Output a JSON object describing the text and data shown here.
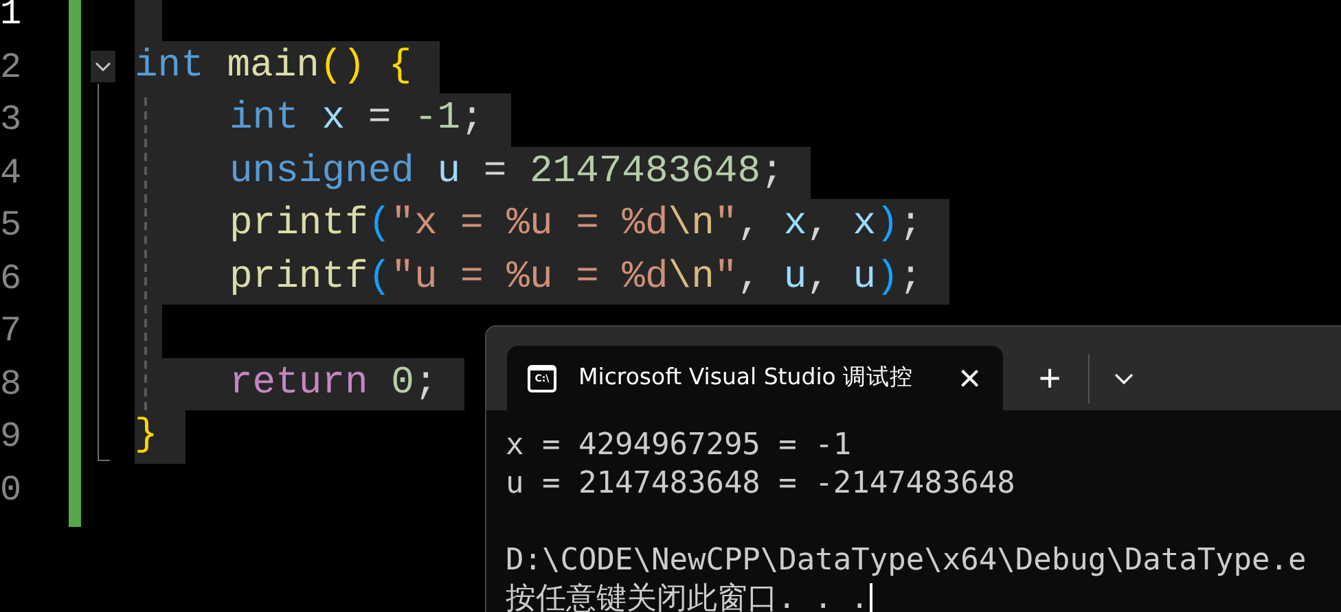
{
  "editor": {
    "lines": [
      {
        "number": "1",
        "current": true,
        "indented": false,
        "selected": true
      },
      {
        "number": "2",
        "current": false,
        "indented": false,
        "selected": true,
        "expanded": true,
        "tokens": [
          {
            "text": "int ",
            "kind": "type"
          },
          {
            "text": "main",
            "kind": "function"
          },
          {
            "text": "() ",
            "kind": "bracket1"
          },
          {
            "text": "{",
            "kind": "bracket1"
          }
        ]
      },
      {
        "number": "3",
        "current": false,
        "indented": true,
        "selected": true,
        "tokens": [
          {
            "text": "int ",
            "kind": "type"
          },
          {
            "text": "x",
            "kind": "variable"
          },
          {
            "text": " = ",
            "kind": "plain"
          },
          {
            "text": "-1",
            "kind": "number"
          },
          {
            "text": ";",
            "kind": "plain"
          }
        ]
      },
      {
        "number": "4",
        "current": false,
        "indented": true,
        "selected": true,
        "tokens": [
          {
            "text": "unsigned ",
            "kind": "type"
          },
          {
            "text": "u",
            "kind": "variable"
          },
          {
            "text": " = ",
            "kind": "plain"
          },
          {
            "text": "2147483648",
            "kind": "number"
          },
          {
            "text": ";",
            "kind": "plain"
          }
        ]
      },
      {
        "number": "5",
        "current": false,
        "indented": true,
        "selected": true,
        "tokens": [
          {
            "text": "printf",
            "kind": "function"
          },
          {
            "text": "(",
            "kind": "bracket2"
          },
          {
            "text": "\"x = %u = %d",
            "kind": "string"
          },
          {
            "text": "\\n",
            "kind": "escape"
          },
          {
            "text": "\"",
            "kind": "string"
          },
          {
            "text": ", ",
            "kind": "plain"
          },
          {
            "text": "x",
            "kind": "variable"
          },
          {
            "text": ", ",
            "kind": "plain"
          },
          {
            "text": "x",
            "kind": "variable"
          },
          {
            "text": ")",
            "kind": "bracket2"
          },
          {
            "text": ";",
            "kind": "plain"
          }
        ]
      },
      {
        "number": "6",
        "current": false,
        "indented": true,
        "selected": true,
        "tokens": [
          {
            "text": "printf",
            "kind": "function"
          },
          {
            "text": "(",
            "kind": "bracket2"
          },
          {
            "text": "\"u = %u = %d",
            "kind": "string"
          },
          {
            "text": "\\n",
            "kind": "escape"
          },
          {
            "text": "\"",
            "kind": "string"
          },
          {
            "text": ", ",
            "kind": "plain"
          },
          {
            "text": "u",
            "kind": "variable"
          },
          {
            "text": ", ",
            "kind": "plain"
          },
          {
            "text": "u",
            "kind": "variable"
          },
          {
            "text": ")",
            "kind": "bracket2"
          },
          {
            "text": ";",
            "kind": "plain"
          }
        ]
      },
      {
        "number": "7",
        "current": false,
        "indented": false,
        "selected": true
      },
      {
        "number": "8",
        "current": false,
        "indented": true,
        "selected": true,
        "tokens": [
          {
            "text": "return ",
            "kind": "control"
          },
          {
            "text": "0",
            "kind": "number"
          },
          {
            "text": ";",
            "kind": "plain"
          }
        ]
      },
      {
        "number": "9",
        "current": false,
        "indented": false,
        "selected": true,
        "tokens": [
          {
            "text": "}",
            "kind": "bracket1"
          }
        ]
      },
      {
        "number": "0",
        "current": false,
        "indented": false,
        "selected": false
      }
    ]
  },
  "terminal": {
    "tab": {
      "icon_label": "C:\\",
      "title": "Microsoft Visual Studio 调试控",
      "close": "×",
      "selected": true
    },
    "new_tab": "+",
    "result_lines": [
      "x = 4294967295 = -1",
      "u = 2147483648 = -2147483648"
    ],
    "prompt_lines": [
      "D:\\CODE\\NewCPP\\DataType\\x64\\Debug\\DataType.e",
      "按任意键关闭此窗口. . ."
    ]
  }
}
